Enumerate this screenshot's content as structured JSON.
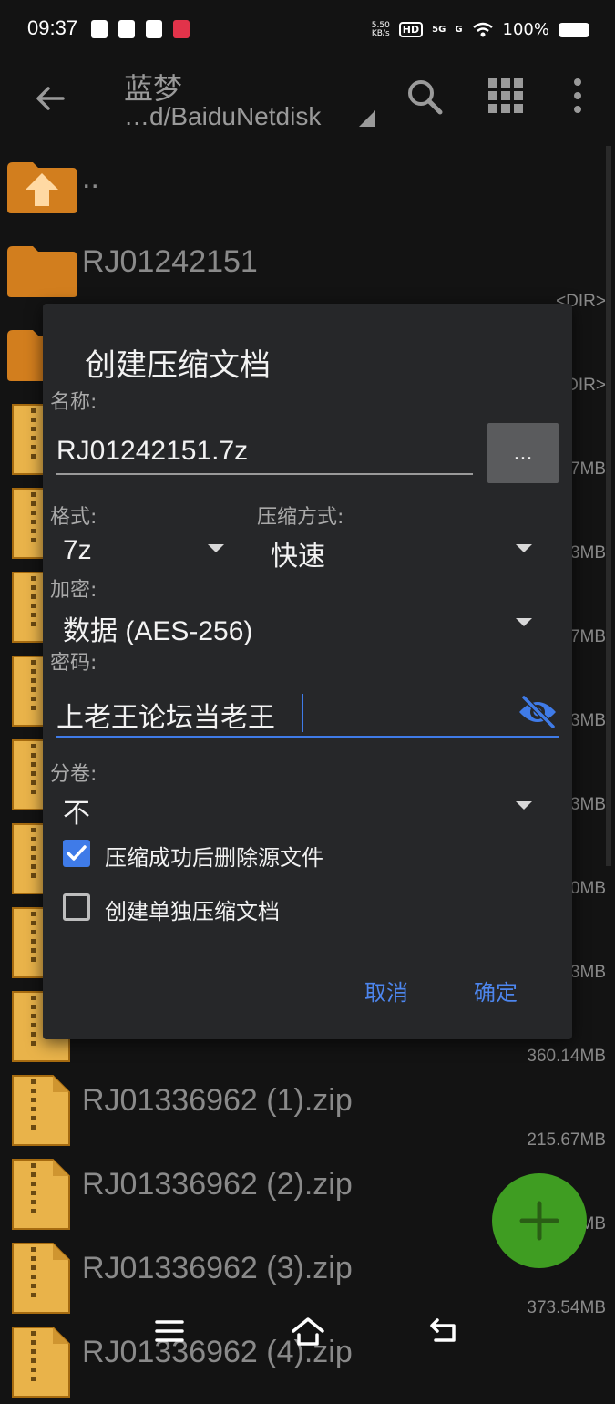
{
  "status_bar": {
    "time": "09:37",
    "speed_value": "5.50",
    "speed_unit": "KB/s",
    "hd": "HD",
    "signal_5g": "5G",
    "signal_g": "G",
    "battery": "100%"
  },
  "app_bar": {
    "title": "蓝梦",
    "path": "…d/BaiduNetdisk"
  },
  "files": [
    {
      "name": "..",
      "size": "",
      "type": "up"
    },
    {
      "name": "RJ01242151",
      "size": "<DIR>",
      "type": "folder"
    },
    {
      "name": "",
      "size": "DIR>",
      "type": "folder"
    },
    {
      "name": "",
      "size": "7MB",
      "type": "zip"
    },
    {
      "name": "",
      "size": "3MB",
      "type": "zip"
    },
    {
      "name": "",
      "size": "7MB",
      "type": "zip"
    },
    {
      "name": "",
      "size": "3MB",
      "type": "zip"
    },
    {
      "name": "",
      "size": "3MB",
      "type": "zip"
    },
    {
      "name": "",
      "size": "0MB",
      "type": "zip"
    },
    {
      "name": "",
      "size": "3MB",
      "type": "zip"
    },
    {
      "name": "",
      "size": "360.14MB",
      "type": "zip"
    },
    {
      "name": "RJ01336962 (1).zip",
      "size": "215.67MB",
      "type": "zip"
    },
    {
      "name": "RJ01336962 (2).zip",
      "size": "MB",
      "type": "zip"
    },
    {
      "name": "RJ01336962 (3).zip",
      "size": "373.54MB",
      "type": "zip"
    },
    {
      "name": "RJ01336962 (4).zip",
      "size": "",
      "type": "zip"
    }
  ],
  "dialog": {
    "title": "创建压缩文档",
    "name_label": "名称:",
    "name_value": "RJ01242151.7z",
    "browse_label": "...",
    "format_label": "格式:",
    "format_value": "7z",
    "method_label": "压缩方式:",
    "method_value": "快速",
    "encryption_label": "加密:",
    "encryption_value": "数据 (AES-256)",
    "password_label": "密码:",
    "password_value": "上老王论坛当老王",
    "split_label": "分卷:",
    "split_value": "不",
    "delete_source_label": "压缩成功后删除源文件",
    "delete_source_checked": true,
    "separate_archive_label": "创建单独压缩文档",
    "separate_archive_checked": false,
    "cancel_label": "取消",
    "ok_label": "确定"
  },
  "colors": {
    "accent": "#3f7be8",
    "folder": "#d27e1e",
    "fab": "#3f9d22",
    "dialog_bg": "#262729",
    "page_bg": "#131313"
  }
}
